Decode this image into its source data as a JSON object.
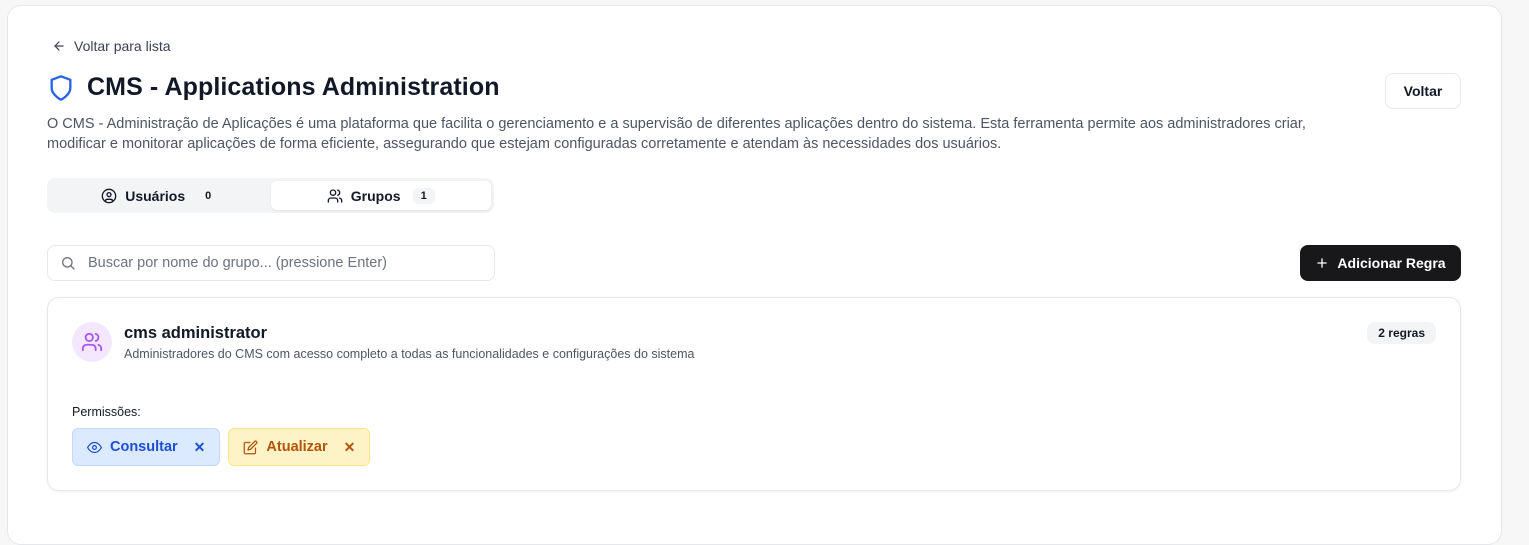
{
  "back_link": {
    "label": "Voltar para lista",
    "icon": "arrow-left-icon"
  },
  "header": {
    "title": "CMS - Applications Administration",
    "icon": "shield-icon",
    "voltar_label": "Voltar",
    "description": "O CMS - Administração de Aplicações é uma plataforma que facilita o gerenciamento e a supervisão de diferentes aplicações dentro do sistema. Esta ferramenta permite aos administradores criar, modificar e monitorar aplicações de forma eficiente, assegurando que estejam configuradas corretamente e atendam às necessidades dos usuários."
  },
  "tabs": [
    {
      "label": "Usuários",
      "count": "0",
      "icon": "user-circle-icon",
      "active": false
    },
    {
      "label": "Grupos",
      "count": "1",
      "icon": "users-icon",
      "active": true
    }
  ],
  "search": {
    "placeholder": "Buscar por nome do grupo... (pressione Enter)",
    "value": ""
  },
  "add_rule": {
    "label": "Adicionar Regra"
  },
  "group": {
    "name": "cms administrator",
    "description": "Administradores do CMS com acesso completo a todas as funcionalidades e configurações do sistema",
    "rules_badge": "2 regras",
    "permissions_label": "Permissões:",
    "permissions": [
      {
        "label": "Consultar",
        "icon": "eye-icon",
        "remove": "✕"
      },
      {
        "label": "Atualizar",
        "icon": "edit-icon",
        "remove": "✕"
      }
    ]
  },
  "colors": {
    "accent": "#1d4ed8",
    "primary_button": "#18181b",
    "avatar_bg": "#f3e8ff",
    "avatar_icon": "#a855f7",
    "chip_blue_bg": "#dbeafe",
    "chip_yellow_bg": "#fef3c7"
  }
}
